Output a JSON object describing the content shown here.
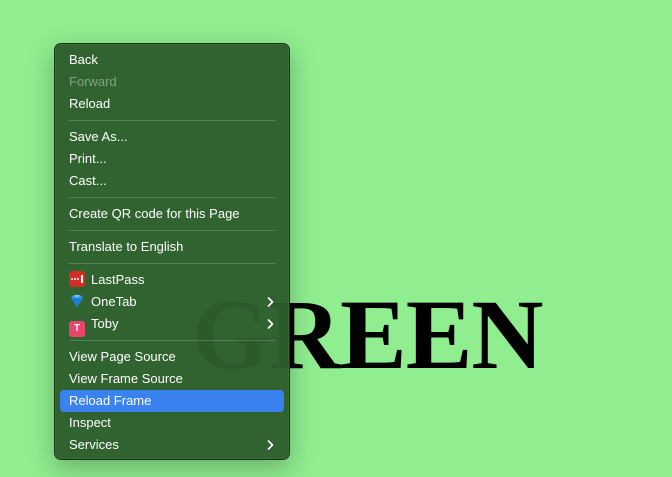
{
  "page": {
    "heading": "GREEN",
    "background": "#90ee90"
  },
  "context_menu": {
    "groups": [
      [
        {
          "label": "Back",
          "enabled": true
        },
        {
          "label": "Forward",
          "enabled": false
        },
        {
          "label": "Reload",
          "enabled": true
        }
      ],
      [
        {
          "label": "Save As..."
        },
        {
          "label": "Print..."
        },
        {
          "label": "Cast..."
        }
      ],
      [
        {
          "label": "Create QR code for this Page"
        }
      ],
      [
        {
          "label": "Translate to English"
        }
      ],
      [
        {
          "label": "LastPass",
          "icon": "lastpass-icon"
        },
        {
          "label": "OneTab",
          "icon": "onetab-icon",
          "submenu": true
        },
        {
          "label": "Toby",
          "icon": "toby-icon",
          "submenu": true
        }
      ],
      [
        {
          "label": "View Page Source"
        },
        {
          "label": "View Frame Source"
        },
        {
          "label": "Reload Frame",
          "selected": true
        },
        {
          "label": "Inspect"
        },
        {
          "label": "Services",
          "submenu": true
        }
      ]
    ],
    "selected_color": "#3a82f0",
    "menu_color": "#2c5e2c"
  }
}
